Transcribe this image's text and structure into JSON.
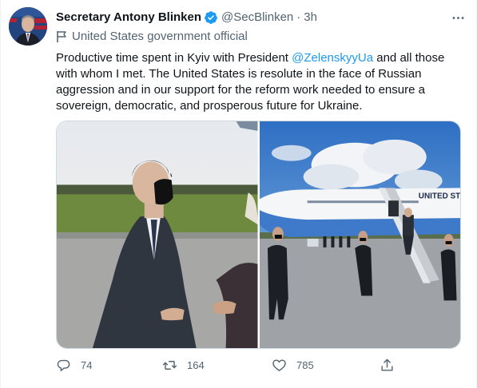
{
  "author": {
    "name": "Secretary Antony Blinken",
    "handle": "@SecBlinken",
    "separator": "·",
    "time": "3h",
    "label": "United States government official"
  },
  "tweet": {
    "text_before": "Productive time spent in Kyiv with President ",
    "mention": "@ZelenskyyUa",
    "text_after": " and all those with whom I met. The United States is resolute in the face of Russian aggression and in our support for the reform work needed to ensure a sovereign, democratic, and prosperous future for Ukraine."
  },
  "media": {
    "aircraft_text": "UNITED STATES"
  },
  "actions": {
    "replies": "74",
    "retweets": "164",
    "likes": "785"
  },
  "colors": {
    "link": "#1d9bf0",
    "secondary": "#536471",
    "primary": "#0f1419"
  }
}
